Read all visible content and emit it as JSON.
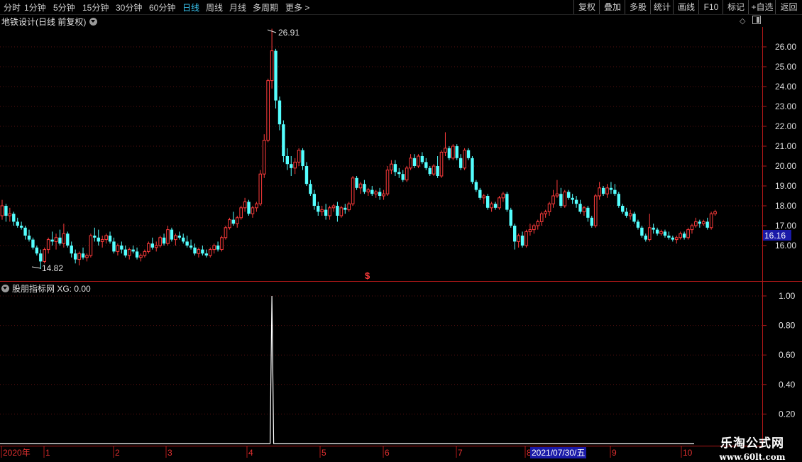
{
  "toolbar": {
    "periods": [
      {
        "label": "分时",
        "active": false
      },
      {
        "label": "1分钟",
        "active": false
      },
      {
        "label": "5分钟",
        "active": false
      },
      {
        "label": "15分钟",
        "active": false
      },
      {
        "label": "30分钟",
        "active": false
      },
      {
        "label": "60分钟",
        "active": false
      },
      {
        "label": "日线",
        "active": true
      },
      {
        "label": "周线",
        "active": false
      },
      {
        "label": "月线",
        "active": false
      },
      {
        "label": "多周期",
        "active": false
      },
      {
        "label": "更多 >",
        "active": false
      }
    ],
    "right_buttons": [
      "复权",
      "叠加",
      "多股",
      "统计",
      "画线",
      "F10",
      "标记",
      "+自选",
      "返回"
    ]
  },
  "main_chart": {
    "title": "地铁设计(日线 前复权)",
    "last_price": "16.16",
    "high_label": "26.91",
    "low_label": "14.82",
    "signal_marker": "$",
    "y_ticks": [
      "26.00",
      "25.00",
      "24.00",
      "23.00",
      "22.00",
      "21.00",
      "20.00",
      "19.00",
      "18.00",
      "17.00",
      "16.00"
    ]
  },
  "indicator": {
    "title": "股朋指标网 XG: 0.00",
    "y_ticks": [
      "1.00",
      "0.80",
      "0.60",
      "0.40",
      "0.20"
    ]
  },
  "date_axis": {
    "labels": [
      "2020年",
      "1",
      "2",
      "3",
      "4",
      "5",
      "6",
      "7",
      "8",
      "9",
      "10"
    ],
    "cursor_date": "2021/07/30/五"
  },
  "watermark": {
    "line1": "乐淘公式网",
    "line2": "www.60lt.com"
  },
  "colors": {
    "up": "#ff3b3b",
    "down": "#54ffff",
    "axis": "#b01818",
    "active_tab": "#39c4f0",
    "cursor_box": "#1a1aa8"
  },
  "chart_data": {
    "type": "candlestick",
    "ylim": [
      14.6,
      27.2
    ],
    "ohlc": [
      [
        17.5,
        18.3,
        17.3,
        18.0
      ],
      [
        18.0,
        18.1,
        17.2,
        17.5
      ],
      [
        17.5,
        17.9,
        17.2,
        17.6
      ],
      [
        17.6,
        17.7,
        17.0,
        17.2
      ],
      [
        17.2,
        17.4,
        16.9,
        17.0
      ],
      [
        17.0,
        17.2,
        16.8,
        16.9
      ],
      [
        16.9,
        17.0,
        16.3,
        16.5
      ],
      [
        16.5,
        16.8,
        16.2,
        16.3
      ],
      [
        16.3,
        16.4,
        15.8,
        15.9
      ],
      [
        15.9,
        16.0,
        15.5,
        15.6
      ],
      [
        15.6,
        15.8,
        14.82,
        15.2
      ],
      [
        15.2,
        15.9,
        15.1,
        15.8
      ],
      [
        15.8,
        16.4,
        15.6,
        16.3
      ],
      [
        16.3,
        16.7,
        16.0,
        16.2
      ],
      [
        16.2,
        16.6,
        15.8,
        16.4
      ],
      [
        16.4,
        16.8,
        16.0,
        16.1
      ],
      [
        16.1,
        17.1,
        15.9,
        16.6
      ],
      [
        16.6,
        16.7,
        15.9,
        16.0
      ],
      [
        16.0,
        16.2,
        15.4,
        15.6
      ],
      [
        15.6,
        15.8,
        15.1,
        15.3
      ],
      [
        15.3,
        15.7,
        15.0,
        15.6
      ],
      [
        15.6,
        15.9,
        15.3,
        15.4
      ],
      [
        15.4,
        15.6,
        15.2,
        15.5
      ],
      [
        15.5,
        16.6,
        15.4,
        16.5
      ],
      [
        16.5,
        16.9,
        16.2,
        16.4
      ],
      [
        16.4,
        16.8,
        16.0,
        16.2
      ],
      [
        16.2,
        16.5,
        15.9,
        16.3
      ],
      [
        16.3,
        16.6,
        16.1,
        16.5
      ],
      [
        16.5,
        16.7,
        16.1,
        16.2
      ],
      [
        16.2,
        16.4,
        15.6,
        15.7
      ],
      [
        15.7,
        16.1,
        15.5,
        16.0
      ],
      [
        16.0,
        16.2,
        15.6,
        15.8
      ],
      [
        15.8,
        16.0,
        15.4,
        15.5
      ],
      [
        15.5,
        15.9,
        15.3,
        15.8
      ],
      [
        15.8,
        16.0,
        15.6,
        15.7
      ],
      [
        15.7,
        15.9,
        15.3,
        15.4
      ],
      [
        15.4,
        15.6,
        15.2,
        15.5
      ],
      [
        15.5,
        15.8,
        15.4,
        15.7
      ],
      [
        15.7,
        16.2,
        15.6,
        16.1
      ],
      [
        16.1,
        16.4,
        15.8,
        15.9
      ],
      [
        15.9,
        16.2,
        15.7,
        16.0
      ],
      [
        16.0,
        16.5,
        15.9,
        16.4
      ],
      [
        16.4,
        16.6,
        16.0,
        16.1
      ],
      [
        16.1,
        17.0,
        16.0,
        16.8
      ],
      [
        16.8,
        16.9,
        16.2,
        16.3
      ],
      [
        16.3,
        16.6,
        16.0,
        16.5
      ],
      [
        16.5,
        16.7,
        16.3,
        16.4
      ],
      [
        16.4,
        16.6,
        16.1,
        16.2
      ],
      [
        16.2,
        16.5,
        15.9,
        16.0
      ],
      [
        16.0,
        16.3,
        15.8,
        15.9
      ],
      [
        15.9,
        16.1,
        15.5,
        15.6
      ],
      [
        15.6,
        15.9,
        15.4,
        15.8
      ],
      [
        15.8,
        16.0,
        15.5,
        15.6
      ],
      [
        15.6,
        15.8,
        15.4,
        15.5
      ],
      [
        15.5,
        15.9,
        15.4,
        15.8
      ],
      [
        15.8,
        16.1,
        15.6,
        16.0
      ],
      [
        16.0,
        16.2,
        15.7,
        15.8
      ],
      [
        15.8,
        16.5,
        15.7,
        16.4
      ],
      [
        16.4,
        17.0,
        16.3,
        16.9
      ],
      [
        16.9,
        17.4,
        16.8,
        17.3
      ],
      [
        17.3,
        17.7,
        17.0,
        17.1
      ],
      [
        17.1,
        17.5,
        16.9,
        17.4
      ],
      [
        17.4,
        18.0,
        17.3,
        17.9
      ],
      [
        17.9,
        18.4,
        17.7,
        18.2
      ],
      [
        18.2,
        18.3,
        17.5,
        17.6
      ],
      [
        17.6,
        18.0,
        17.4,
        17.9
      ],
      [
        17.9,
        18.2,
        17.7,
        18.1
      ],
      [
        18.1,
        19.8,
        18.0,
        19.6
      ],
      [
        19.6,
        21.6,
        19.4,
        21.3
      ],
      [
        21.3,
        24.4,
        21.2,
        24.3
      ],
      [
        24.3,
        26.91,
        23.9,
        25.8
      ],
      [
        25.8,
        25.9,
        22.9,
        23.3
      ],
      [
        23.3,
        23.5,
        21.8,
        22.1
      ],
      [
        22.1,
        22.3,
        20.2,
        20.5
      ],
      [
        20.5,
        20.9,
        19.8,
        20.1
      ],
      [
        20.1,
        20.5,
        19.5,
        19.9
      ],
      [
        19.9,
        20.4,
        19.6,
        20.2
      ],
      [
        20.2,
        20.9,
        20.0,
        20.8
      ],
      [
        20.8,
        20.9,
        19.8,
        20.0
      ],
      [
        20.0,
        20.2,
        19.0,
        19.1
      ],
      [
        19.1,
        19.3,
        18.5,
        18.6
      ],
      [
        18.6,
        18.8,
        17.8,
        18.0
      ],
      [
        18.0,
        18.2,
        17.5,
        17.7
      ],
      [
        17.7,
        18.0,
        17.5,
        17.8
      ],
      [
        17.8,
        18.1,
        17.3,
        17.5
      ],
      [
        17.5,
        18.0,
        17.3,
        17.9
      ],
      [
        17.9,
        18.1,
        17.7,
        18.0
      ],
      [
        18.0,
        18.2,
        17.2,
        17.5
      ],
      [
        17.5,
        18.0,
        17.4,
        17.9
      ],
      [
        17.9,
        18.1,
        17.6,
        17.8
      ],
      [
        17.8,
        18.2,
        17.7,
        18.1
      ],
      [
        18.1,
        19.5,
        18.0,
        19.4
      ],
      [
        19.4,
        19.5,
        18.8,
        18.9
      ],
      [
        18.9,
        19.2,
        18.6,
        19.1
      ],
      [
        19.1,
        19.3,
        18.6,
        18.7
      ],
      [
        18.7,
        18.9,
        18.5,
        18.8
      ],
      [
        18.8,
        19.0,
        18.5,
        18.6
      ],
      [
        18.6,
        18.8,
        18.4,
        18.7
      ],
      [
        18.7,
        18.9,
        18.3,
        18.5
      ],
      [
        18.5,
        18.8,
        18.3,
        18.6
      ],
      [
        18.6,
        20.0,
        18.5,
        19.8
      ],
      [
        19.8,
        20.3,
        19.6,
        20.1
      ],
      [
        20.1,
        20.3,
        19.5,
        19.7
      ],
      [
        19.7,
        19.9,
        19.4,
        19.6
      ],
      [
        19.6,
        19.8,
        19.2,
        19.3
      ],
      [
        19.3,
        20.0,
        19.2,
        19.9
      ],
      [
        19.9,
        20.6,
        19.8,
        20.4
      ],
      [
        20.4,
        20.6,
        19.9,
        20.0
      ],
      [
        20.0,
        20.6,
        19.9,
        20.5
      ],
      [
        20.5,
        20.7,
        20.1,
        20.2
      ],
      [
        20.2,
        20.4,
        19.8,
        19.9
      ],
      [
        19.9,
        20.0,
        19.5,
        19.6
      ],
      [
        19.6,
        20.1,
        19.5,
        20.0
      ],
      [
        20.0,
        20.5,
        19.4,
        19.5
      ],
      [
        19.5,
        20.8,
        19.4,
        20.7
      ],
      [
        20.7,
        21.7,
        20.5,
        20.9
      ],
      [
        20.9,
        21.0,
        20.3,
        20.4
      ],
      [
        20.4,
        21.1,
        20.3,
        21.0
      ],
      [
        21.0,
        21.1,
        20.3,
        20.4
      ],
      [
        20.4,
        20.6,
        19.8,
        19.9
      ],
      [
        19.9,
        20.9,
        19.8,
        20.8
      ],
      [
        20.8,
        20.9,
        20.3,
        20.4
      ],
      [
        20.4,
        20.5,
        19.1,
        19.2
      ],
      [
        19.2,
        19.3,
        18.7,
        18.8
      ],
      [
        18.8,
        18.9,
        18.3,
        18.4
      ],
      [
        18.4,
        18.6,
        18.1,
        18.5
      ],
      [
        18.5,
        18.6,
        17.8,
        17.9
      ],
      [
        17.9,
        18.2,
        17.7,
        18.1
      ],
      [
        18.1,
        18.2,
        17.8,
        17.9
      ],
      [
        17.9,
        18.5,
        17.8,
        18.4
      ],
      [
        18.4,
        18.7,
        18.2,
        18.6
      ],
      [
        18.6,
        18.7,
        17.7,
        17.8
      ],
      [
        17.8,
        17.9,
        16.9,
        17.0
      ],
      [
        17.0,
        17.1,
        15.8,
        16.2
      ],
      [
        16.2,
        16.6,
        15.9,
        16.5
      ],
      [
        16.5,
        16.7,
        15.9,
        16.0
      ],
      [
        16.0,
        16.8,
        15.9,
        16.7
      ],
      [
        16.7,
        17.1,
        16.5,
        16.8
      ],
      [
        16.8,
        17.1,
        16.6,
        17.0
      ],
      [
        17.0,
        17.3,
        16.8,
        17.2
      ],
      [
        17.2,
        17.7,
        17.0,
        17.6
      ],
      [
        17.6,
        17.8,
        17.4,
        17.7
      ],
      [
        17.7,
        18.2,
        17.5,
        18.1
      ],
      [
        18.1,
        18.8,
        17.9,
        18.5
      ],
      [
        18.5,
        19.3,
        18.4,
        18.6
      ],
      [
        18.6,
        18.9,
        17.9,
        18.0
      ],
      [
        18.0,
        18.8,
        17.9,
        18.7
      ],
      [
        18.7,
        18.8,
        18.3,
        18.4
      ],
      [
        18.4,
        18.6,
        18.1,
        18.3
      ],
      [
        18.3,
        18.5,
        17.9,
        18.1
      ],
      [
        18.1,
        18.3,
        17.6,
        17.7
      ],
      [
        17.7,
        18.0,
        17.5,
        17.9
      ],
      [
        17.9,
        18.0,
        17.2,
        17.4
      ],
      [
        17.4,
        17.5,
        16.9,
        17.0
      ],
      [
        17.0,
        18.6,
        16.9,
        18.5
      ],
      [
        18.5,
        19.2,
        18.3,
        18.9
      ],
      [
        18.9,
        19.0,
        18.5,
        18.6
      ],
      [
        18.6,
        19.1,
        18.4,
        18.9
      ],
      [
        18.9,
        19.2,
        18.6,
        18.8
      ],
      [
        18.8,
        19.1,
        18.5,
        18.6
      ],
      [
        18.6,
        18.7,
        17.9,
        18.0
      ],
      [
        18.0,
        18.1,
        17.6,
        17.7
      ],
      [
        17.7,
        17.9,
        17.4,
        17.5
      ],
      [
        17.5,
        17.8,
        17.3,
        17.6
      ],
      [
        17.6,
        17.7,
        17.1,
        17.2
      ],
      [
        17.2,
        17.3,
        16.8,
        16.9
      ],
      [
        16.9,
        17.0,
        16.4,
        16.5
      ],
      [
        16.5,
        16.6,
        16.2,
        16.3
      ],
      [
        16.3,
        17.6,
        16.2,
        16.9
      ],
      [
        16.9,
        17.1,
        16.6,
        16.8
      ],
      [
        16.8,
        16.9,
        16.5,
        16.6
      ],
      [
        16.6,
        16.8,
        16.5,
        16.7
      ],
      [
        16.7,
        16.8,
        16.4,
        16.5
      ],
      [
        16.5,
        16.7,
        16.3,
        16.4
      ],
      [
        16.4,
        16.5,
        16.2,
        16.3
      ],
      [
        16.3,
        16.5,
        16.1,
        16.4
      ],
      [
        16.4,
        16.7,
        16.3,
        16.6
      ],
      [
        16.6,
        16.7,
        16.3,
        16.4
      ],
      [
        16.4,
        16.9,
        16.3,
        16.8
      ],
      [
        16.8,
        17.1,
        16.6,
        17.0
      ],
      [
        17.0,
        17.4,
        16.9,
        17.2
      ],
      [
        17.2,
        17.3,
        16.9,
        17.1
      ],
      [
        17.1,
        17.3,
        17.0,
        17.2
      ],
      [
        17.2,
        17.4,
        16.8,
        16.9
      ],
      [
        16.9,
        17.7,
        16.8,
        17.6
      ],
      [
        17.6,
        17.8,
        17.5,
        17.7
      ]
    ],
    "indicator_series": {
      "name": "XG",
      "spike_at_index": 70,
      "value": 1.0,
      "baseline": 0.0
    }
  }
}
